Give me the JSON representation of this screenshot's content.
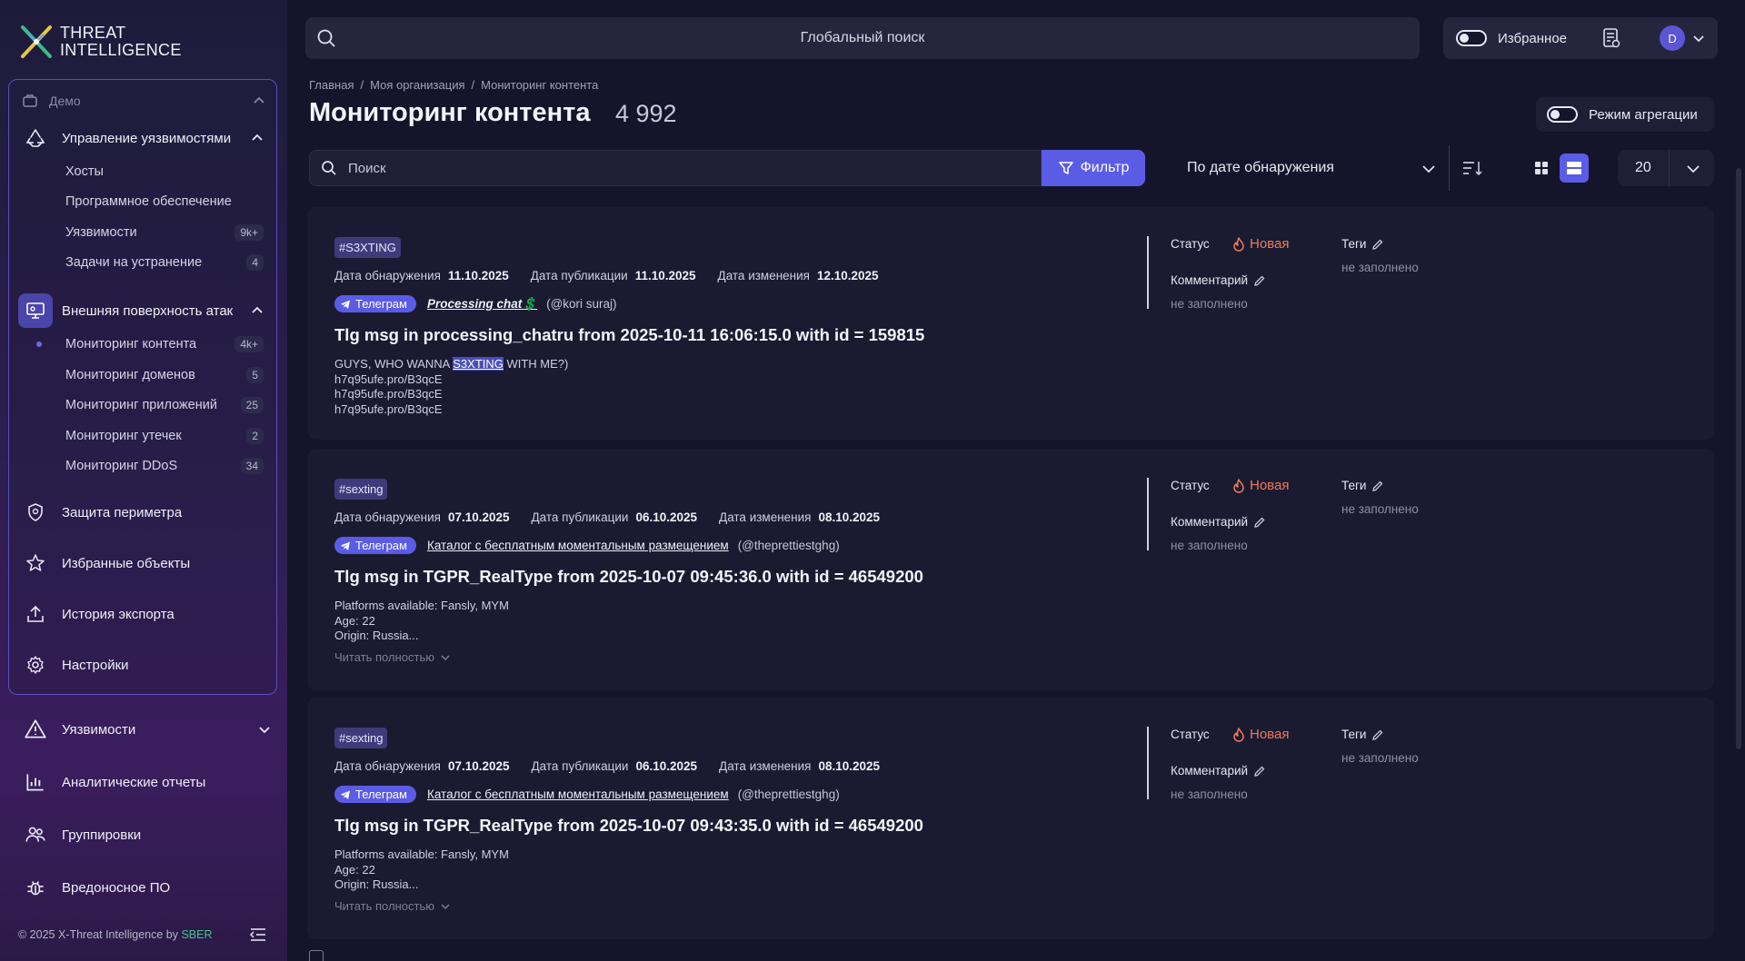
{
  "app": {
    "logo_line1": "THREAT",
    "logo_line2": "INTELLIGENCE",
    "accent": "#5b5ce6",
    "status_color": "#f0795a"
  },
  "sidebar": {
    "group_label": "Демо",
    "section1": {
      "label": "Управление уязвимостями",
      "items": [
        {
          "label": "Хосты",
          "count": ""
        },
        {
          "label": "Программное обеспечение",
          "count": ""
        },
        {
          "label": "Уязвимости",
          "count": "9k+"
        },
        {
          "label": "Задачи на устранение",
          "count": "4"
        }
      ]
    },
    "section2": {
      "label": "Внешняя поверхность атак",
      "items": [
        {
          "label": "Мониторинг контента",
          "count": "4k+"
        },
        {
          "label": "Мониторинг доменов",
          "count": "5"
        },
        {
          "label": "Мониторинг приложений",
          "count": "25"
        },
        {
          "label": "Мониторинг утечек",
          "count": "2"
        },
        {
          "label": "Мониторинг DDoS",
          "count": "34"
        }
      ]
    },
    "nav_demo": [
      {
        "label": "Защита периметра",
        "icon": "shield-search-icon"
      },
      {
        "label": "Избранные объекты",
        "icon": "star-icon"
      },
      {
        "label": "История экспорта",
        "icon": "export-icon"
      },
      {
        "label": "Настройки",
        "icon": "gear-icon"
      }
    ],
    "nav_main": [
      {
        "label": "Уязвимости",
        "icon": "warning-icon"
      },
      {
        "label": "Аналитические отчеты",
        "icon": "chart-icon"
      },
      {
        "label": "Группировки",
        "icon": "group-icon"
      },
      {
        "label": "Вредоносное ПО",
        "icon": "bug-icon"
      }
    ],
    "footer_text": "© 2025 X-Threat Intelligence by ",
    "footer_brand": "SBER"
  },
  "topbar": {
    "search_placeholder": "Глобальный поиск",
    "favorites_label": "Избранное",
    "avatar_letter": "D"
  },
  "page": {
    "breadcrumbs": [
      "Главная",
      "Моя организация",
      "Мониторинг контента"
    ],
    "title": "Мониторинг контента",
    "count": "4 992",
    "aggregation_label": "Режим агрегации",
    "search_placeholder": "Поиск",
    "filter_label": "Фильтр",
    "sort_label": "По дате обнаружения",
    "per_page": "20"
  },
  "labels": {
    "detected": "Дата обнаружения",
    "published": "Дата публикации",
    "modified": "Дата изменения",
    "status": "Статус",
    "comment": "Комментарий",
    "tags": "Теги",
    "empty": "не заполнено",
    "source": "Телеграм",
    "read_more": "Читать полностью"
  },
  "cards": [
    {
      "tag": "#S3XTING",
      "detected": "11.10.2025",
      "published": "11.10.2025",
      "modified": "12.10.2025",
      "chat": "Processing chat💲",
      "handle": "(@kori suraj)",
      "title": "Tlg msg in processing_chatru from 2025-10-11 16:06:15.0 with id = 159815",
      "body_pre": "GUYS, WHO WANNA ",
      "body_hl": "S3XTING",
      "body_post": " WITH ME?)",
      "lines": [
        "h7q95ufe.pro/B3qcE",
        "h7q95ufe.pro/B3qcE",
        "h7q95ufe.pro/B3qcE"
      ],
      "status": "Новая"
    },
    {
      "tag": "#sexting",
      "detected": "07.10.2025",
      "published": "06.10.2025",
      "modified": "08.10.2025",
      "chat": "Каталог с бесплатным моментальным размещением",
      "handle": "(@theprettiestghg)",
      "title": "Tlg msg in TGPR_RealType from 2025-10-07 09:45:36.0 with id = 46549200",
      "lines": [
        "Platforms available: Fansly, MYM",
        "Age: 22",
        "Origin: Russia..."
      ],
      "status": "Новая"
    },
    {
      "tag": "#sexting",
      "detected": "07.10.2025",
      "published": "06.10.2025",
      "modified": "08.10.2025",
      "chat": "Каталог с бесплатным моментальным размещением",
      "handle": "(@theprettiestghg)",
      "title": "Tlg msg in TGPR_RealType from 2025-10-07 09:43:35.0 with id = 46549200",
      "lines": [
        "Platforms available: Fansly, MYM",
        "Age: 22",
        "Origin: Russia..."
      ],
      "status": "Новая"
    }
  ]
}
